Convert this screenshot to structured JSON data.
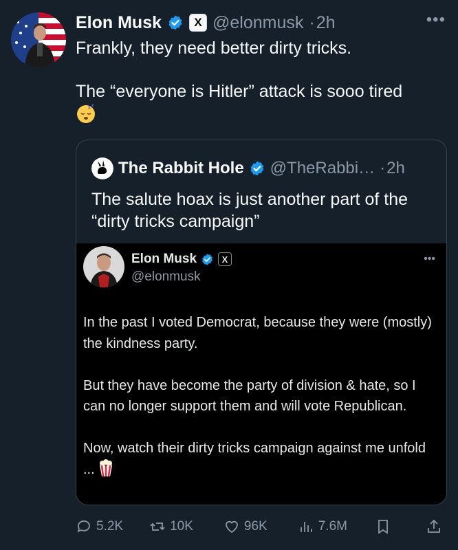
{
  "post": {
    "author_name": "Elon Musk",
    "author_handle": "@elonmusk",
    "time": "2h",
    "x_badge": "X",
    "text_line1": "Frankly, they need better dirty tricks.",
    "text_line2": "The “everyone is Hitler” attack is sooo tired",
    "emoji": "sleeping-face-emoji"
  },
  "quote": {
    "author_name": "The Rabbit Hole",
    "author_handle": "@TheRabbi…",
    "time": "2h",
    "text": "The salute hoax is just another part of the “dirty tricks campaign”"
  },
  "screenshot": {
    "author_name": "Elon Musk",
    "author_handle": "@elonmusk",
    "x_badge": "X",
    "paragraph1": "In the past I voted Democrat, because they were (mostly) the kindness party.",
    "paragraph2": "But they have become the party of division & hate, so I can no longer support them and will vote Republican.",
    "paragraph3": "Now, watch their dirty tricks campaign against me unfold ...",
    "emoji": "popcorn-emoji"
  },
  "actions": {
    "replies": "5.2K",
    "reposts": "10K",
    "likes": "96K",
    "views": "7.6M"
  },
  "colors": {
    "background": "#15202b",
    "verified": "#1d9bf0",
    "muted": "#8b98a5",
    "border": "#38444d"
  }
}
